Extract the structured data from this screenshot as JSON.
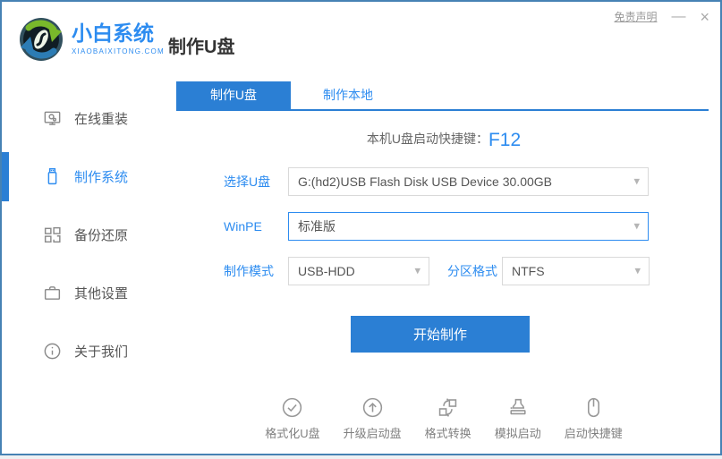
{
  "colors": {
    "primary": "#2b7fd4",
    "link_blue": "#2d8cf0",
    "window_border": "#4682b4"
  },
  "header": {
    "brand_name": "小白系统",
    "brand_domain": "XIAOBAIXITONG.COM",
    "page_title": "制作U盘",
    "disclaimer": "免责声明",
    "minimize": "—",
    "close": "×"
  },
  "sidebar": {
    "items": [
      {
        "label": "在线重装",
        "icon": "monitor-icon",
        "active": false
      },
      {
        "label": "制作系统",
        "icon": "usb-drive-icon",
        "active": true
      },
      {
        "label": "备份还原",
        "icon": "backup-grid-icon",
        "active": false
      },
      {
        "label": "其他设置",
        "icon": "briefcase-icon",
        "active": false
      },
      {
        "label": "关于我们",
        "icon": "info-icon",
        "active": false
      }
    ]
  },
  "tabs": [
    {
      "label": "制作U盘",
      "active": true
    },
    {
      "label": "制作本地",
      "active": false
    }
  ],
  "main": {
    "hotkey_label": "本机U盘启动快捷键：",
    "hotkey_value": "F12",
    "usb_select": {
      "label": "选择U盘",
      "value": "G:(hd2)USB Flash Disk USB Device 30.00GB"
    },
    "winpe_select": {
      "label": "WinPE",
      "value": "标准版"
    },
    "mode_select": {
      "label": "制作模式",
      "value": "USB-HDD"
    },
    "partition_select": {
      "label": "分区格式",
      "value": "NTFS"
    },
    "start_button": "开始制作"
  },
  "footer": {
    "actions": [
      {
        "label": "格式化U盘",
        "icon": "check-circle-icon"
      },
      {
        "label": "升级启动盘",
        "icon": "arrow-up-circle-icon"
      },
      {
        "label": "格式转换",
        "icon": "convert-icon"
      },
      {
        "label": "模拟启动",
        "icon": "stamp-icon"
      },
      {
        "label": "启动快捷键",
        "icon": "mouse-icon"
      }
    ]
  }
}
